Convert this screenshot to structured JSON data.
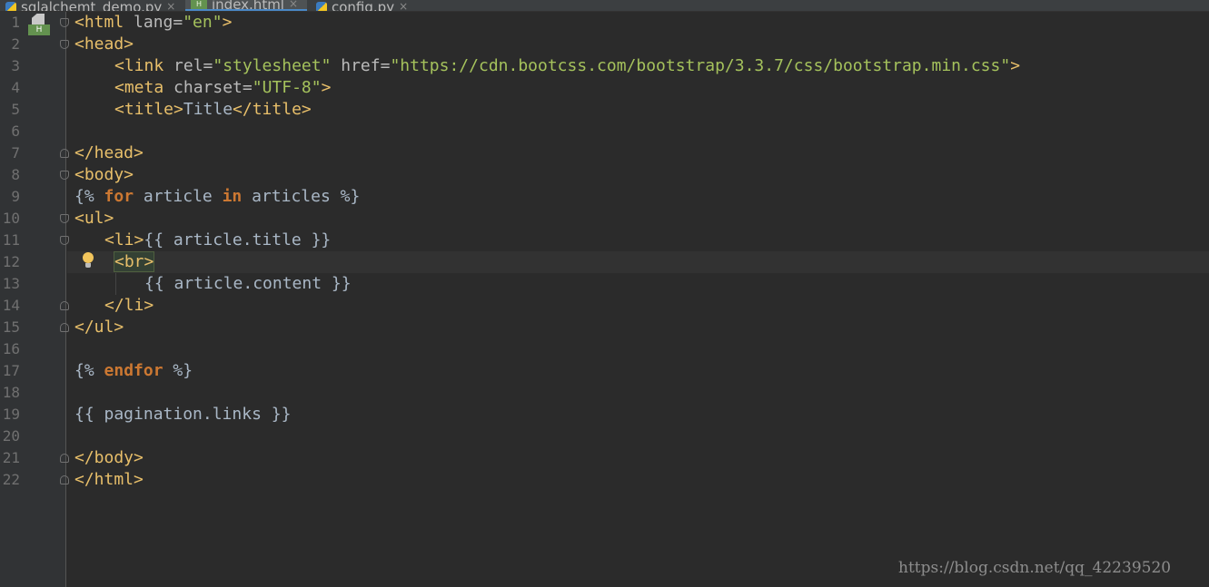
{
  "tabs": [
    {
      "label": "sqlalchemt_demo.py",
      "active": false,
      "icon": "python-file-icon"
    },
    {
      "label": "index.html",
      "active": true,
      "icon": "html-file-icon"
    },
    {
      "label": "config.py",
      "active": false,
      "icon": "python-file-icon"
    }
  ],
  "tab_close": "×",
  "html_icon_letter": "H",
  "line_numbers": [
    "1",
    "2",
    "3",
    "4",
    "5",
    "6",
    "7",
    "8",
    "9",
    "10",
    "11",
    "12",
    "13",
    "14",
    "15",
    "16",
    "17",
    "18",
    "19",
    "20",
    "21",
    "22"
  ],
  "code": {
    "l1": {
      "open": "<html",
      "attr": " lang=",
      "val": "\"en\"",
      "close": ">"
    },
    "l2": {
      "tag": "<head>"
    },
    "l3": {
      "open": "<link",
      "a1": " rel=",
      "v1": "\"stylesheet\"",
      "a2": " href=",
      "v2": "\"https://cdn.bootcss.com/bootstrap/3.3.7/css/bootstrap.min.css\"",
      "close": ">"
    },
    "l4": {
      "open": "<meta",
      "attr": " charset=",
      "val": "\"UTF-8\"",
      "close": ">"
    },
    "l5": {
      "open": "<title>",
      "text": "Title",
      "close": "</title>"
    },
    "l7": {
      "tag": "</head>"
    },
    "l8": {
      "tag": "<body>"
    },
    "l9": {
      "o": "{%",
      "kw1": "for",
      "mid": " article ",
      "kw2": "in",
      "rest": " articles ",
      "c": "%}"
    },
    "l10": {
      "tag": "<ul>"
    },
    "l11": {
      "tag": "<li>",
      "expr": "{{ article.title }}"
    },
    "l12": {
      "tag": "<br>"
    },
    "l13": {
      "expr": "{{ article.content }}"
    },
    "l14": {
      "tag": "</li>"
    },
    "l15": {
      "tag": "</ul>"
    },
    "l17": {
      "o": "{%",
      "kw": "endfor",
      "c": "%}"
    },
    "l19": {
      "expr": "{{ pagination.links }}"
    },
    "l21": {
      "tag": "</body>"
    },
    "l22": {
      "tag": "</html>"
    }
  },
  "watermark": "https://blog.csdn.net/qq_42239520",
  "colors": {
    "background": "#2b2b2b",
    "tag": "#e8bf6a",
    "string": "#a5c25c",
    "keyword": "#cc7832",
    "text": "#a9b7c6"
  }
}
